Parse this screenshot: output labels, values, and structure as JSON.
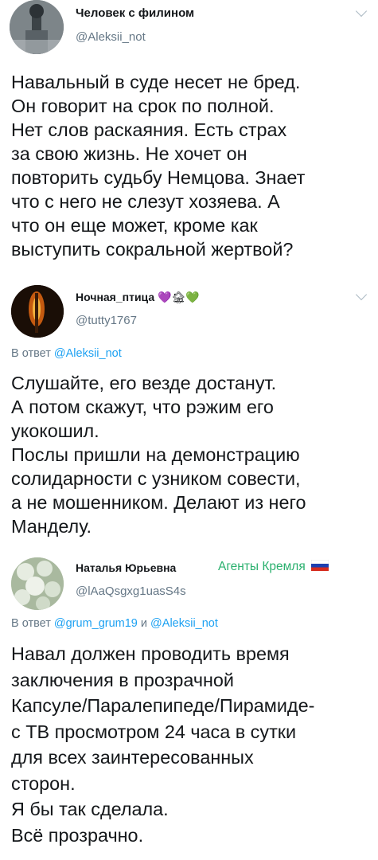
{
  "tweets": [
    {
      "display_name": "Человек с филином",
      "handle": "@Aleksii_not",
      "body_lines": [
        "Навальный в суде несет не бред.",
        "Он говорит на срок по полной.",
        "Нет слов раскаяния. Есть страх",
        "за свою жизнь. Не хочет он",
        "повторить судьбу Немцова. Знает",
        "что с него не слезут хозяева. А",
        "что он еще может,  кроме как",
        "выступить сокральной жертвой?"
      ]
    },
    {
      "display_name": "Ночная_птица",
      "name_emoji": "💜🏚💚",
      "handle": "@tutty1767",
      "reply_prefix": "В ответ",
      "reply_to": "@Aleksii_not",
      "body_lines": [
        "Слушайте, его везде достанут.",
        "А потом скажут, что рэжим его",
        "укокошил.",
        "Послы пришли на демонстрацию",
        "солидарности с узником совести,",
        "а не мошенником. Делают из него",
        "Манделу."
      ]
    },
    {
      "display_name": "Наталья Юрьевна",
      "handle": "@lAaQsgxg1uasS4s",
      "label": "Агенты Кремля",
      "reply_prefix": "В ответ",
      "reply_to_1": "@grum_grum19",
      "reply_and": "и",
      "reply_to_2": "@Aleksii_not",
      "body_lines": [
        "Навал должен проводить время",
        "заключения в прозрачной",
        "Капсуле/Паралепипеде/Пирамиде-",
        "с ТВ просмотром 24 часа в сутки",
        "для всех заинтересованных",
        "сторон.",
        "Я бы так сделала.",
        "Всё прозрачно."
      ]
    }
  ]
}
